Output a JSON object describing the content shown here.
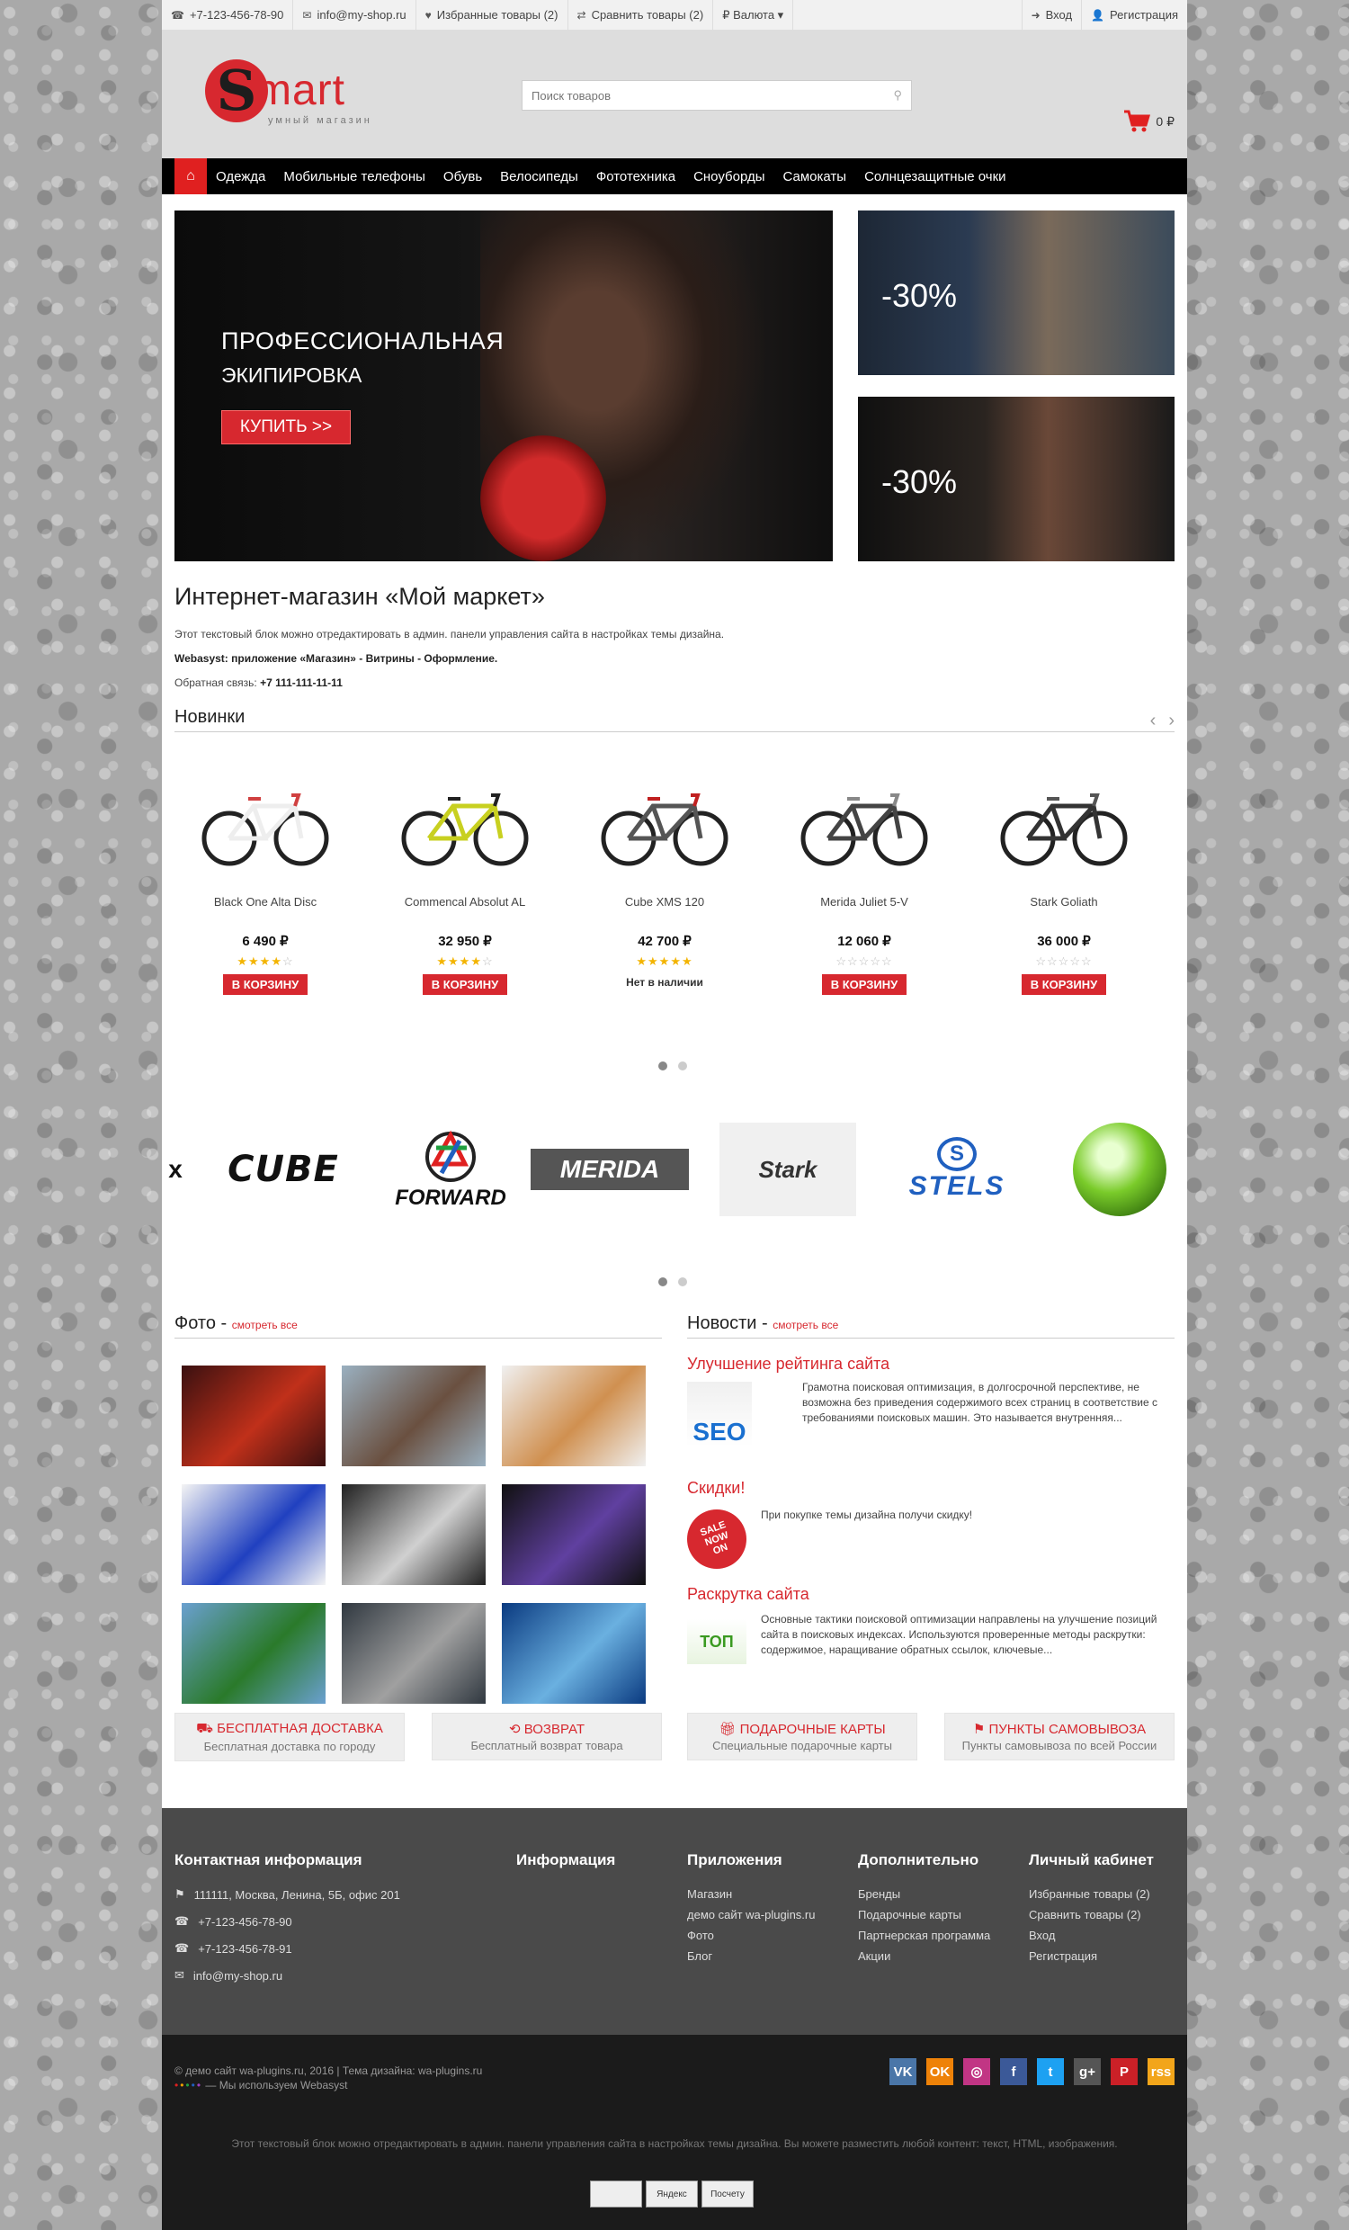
{
  "topbar": {
    "phone": "+7-123-456-78-90",
    "email": "info@my-shop.ru",
    "favorites": "Избранные товары (2)",
    "compare": "Сравнить товары (2)",
    "currency": "₽ Валюта ▾",
    "login": "Вход",
    "register": "Регистрация"
  },
  "header": {
    "logo_letter": "S",
    "logo_word": "mart",
    "logo_tagline": "умный магазин",
    "search_placeholder": "Поиск товаров",
    "cart_total": "0 ₽"
  },
  "nav": {
    "items": [
      "Одежда",
      "Мобильные телефоны",
      "Обувь",
      "Велосипеды",
      "Фототехника",
      "Сноуборды",
      "Самокаты",
      "Солнцезащитные очки"
    ]
  },
  "hero": {
    "line1": "ПРОФЕССИОНАЛЬНАЯ",
    "line2": "ЭКИПИРОВКА",
    "button": "КУПИТЬ >>",
    "promo1": "-30%",
    "promo2": "-30%"
  },
  "about": {
    "title": "Интернет-магазин «Мой маркет»",
    "p1": "Этот текстовый блок можно отредактировать в админ. панели управления сайта в настройках темы дизайна.",
    "p2": "Webasyst: приложение «Магазин» - Витрины - Оформление.",
    "p3_label": "Обратная связь:",
    "p3_phone": "+7 111-111-11-11"
  },
  "new": {
    "title": "Новинки",
    "products": [
      {
        "name": "Black One Alta Disc",
        "price": "6 490 ₽",
        "rating": 4,
        "action": "В КОРЗИНУ",
        "frame": "#eee",
        "accent": "#d04040"
      },
      {
        "name": "Commencal Absolut AL",
        "price": "32 950 ₽",
        "rating": 4,
        "action": "В КОРЗИНУ",
        "frame": "#c8d020",
        "accent": "#222"
      },
      {
        "name": "Cube XMS 120",
        "price": "42 700 ₽",
        "rating": 5,
        "action": "Нет в наличии",
        "frame": "#555",
        "accent": "#c02020"
      },
      {
        "name": "Merida Juliet 5-V",
        "price": "12 060 ₽",
        "rating": 0,
        "action": "В КОРЗИНУ",
        "frame": "#444",
        "accent": "#888"
      },
      {
        "name": "Stark Goliath",
        "price": "36 000 ₽",
        "rating": 0,
        "action": "В КОРЗИНУ",
        "frame": "#333",
        "accent": "#555"
      }
    ]
  },
  "brands": [
    "CUBE",
    "FORWARD",
    "MERIDA",
    "Stark",
    "STELS"
  ],
  "photos": {
    "title": "Фото",
    "link": "смотреть все",
    "tiles": [
      {
        "c1": "#3a1010",
        "c2": "#c0301a"
      },
      {
        "c1": "#9ab0c0",
        "c2": "#6a5040"
      },
      {
        "c1": "#f0f0f0",
        "c2": "#d09050"
      },
      {
        "c1": "#f4f4f4",
        "c2": "#2040c0"
      },
      {
        "c1": "#202020",
        "c2": "#d0d0d0"
      },
      {
        "c1": "#101010",
        "c2": "#6040a0"
      },
      {
        "c1": "#6aa0d0",
        "c2": "#2a7a2a"
      },
      {
        "c1": "#303840",
        "c2": "#a0a0a0"
      },
      {
        "c1": "#0a3a80",
        "c2": "#6ab0e0"
      }
    ]
  },
  "news": {
    "title": "Новости",
    "link": "смотреть все",
    "items": [
      {
        "title": "Улучшение рейтинга сайта",
        "text": "Грамотна поисковая оптимизация, в долгосрочной перспективе, не возможна без приведения содержимого всех страниц в соответствие с требованиями поисковых машин. Это называется внутренняя...",
        "img_label": "SEO"
      },
      {
        "title": "Скидки!",
        "text": "При покупке темы дизайна получи скидку!",
        "img_label": "SALE NOW ON"
      },
      {
        "title": "Раскрутка сайта",
        "text": "Основные тактики поисковой оптимизации направлены на улучшение позиций сайта в поисковых индексах. Используются проверенные методы раскрутки: содержимое, наращивание обратных ссылок, ключевые...",
        "img_label": "ТОП"
      }
    ]
  },
  "features": [
    {
      "title": "БЕСПЛАТНАЯ ДОСТАВКА",
      "sub": "Бесплатная доставка по городу",
      "icon": "truck-icon"
    },
    {
      "title": "ВОЗВРАТ",
      "sub": "Бесплатный возврат товара",
      "icon": "return-icon"
    },
    {
      "title": "ПОДАРОЧНЫЕ КАРТЫ",
      "sub": "Специальные подарочные карты",
      "icon": "gift-icon"
    },
    {
      "title": "ПУНКТЫ САМОВЫВОЗА",
      "sub": "Пункты самовывоза по всей России",
      "icon": "map-marker-icon"
    }
  ],
  "footer": {
    "contacts_title": "Контактная информация",
    "address": "111111, Москва, Ленина, 5Б, офис 201",
    "phone1": "+7-123-456-78-90",
    "phone2": "+7-123-456-78-91",
    "email": "info@my-shop.ru",
    "info_title": "Информация",
    "apps_title": "Приложения",
    "apps": [
      "Магазин",
      "демо сайт wa-plugins.ru",
      "Фото",
      "Блог"
    ],
    "extra_title": "Дополнительно",
    "extra": [
      "Бренды",
      "Подарочные карты",
      "Партнерская программа",
      "Акции"
    ],
    "account_title": "Личный кабинет",
    "account": [
      "Избранные товары (2)",
      "Сравнить товары (2)",
      "Вход",
      "Регистрация"
    ]
  },
  "bottom": {
    "copyright": "© демо сайт wa-plugins.ru, 2016 | Тема дизайна: wa-plugins.ru",
    "webasyst": "— Мы используем Webasyst",
    "note": "Этот текстовый блок можно отредактировать в админ. панели управления сайта в настройках темы дизайна. Вы можете разместить любой контент: текст, HTML, изображения.",
    "socials": [
      {
        "label": "VK",
        "color": "#4a76a8",
        "icon": "vk-icon"
      },
      {
        "label": "OK",
        "color": "#ee8208",
        "icon": "odnoklassniki-icon"
      },
      {
        "label": "◎",
        "color": "#c13584",
        "icon": "instagram-icon"
      },
      {
        "label": "f",
        "color": "#3b5998",
        "icon": "facebook-icon"
      },
      {
        "label": "t",
        "color": "#1da1f2",
        "icon": "twitter-icon"
      },
      {
        "label": "g+",
        "color": "#555",
        "icon": "google-plus-icon"
      },
      {
        "label": "P",
        "color": "#cb2027",
        "icon": "pinterest-icon"
      },
      {
        "label": "rss",
        "color": "#f2a51a",
        "icon": "rss-icon"
      }
    ],
    "counters": [
      "",
      "Яндекс",
      "Посчету"
    ]
  }
}
